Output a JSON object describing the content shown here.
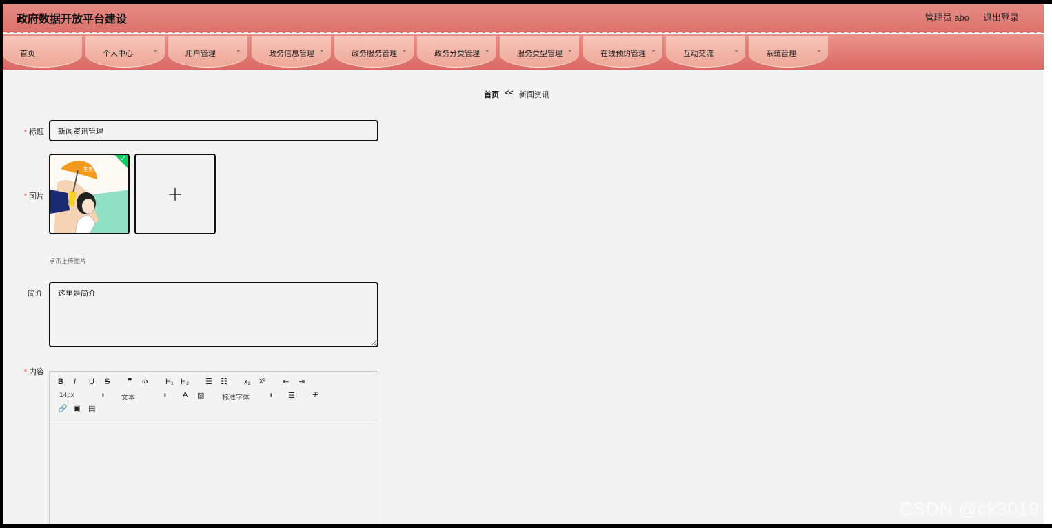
{
  "header": {
    "site_title": "政府数据开放平台建设",
    "user_label": "管理员 abo",
    "logout_label": "退出登录"
  },
  "nav": {
    "items": [
      {
        "label": "首页",
        "has_dropdown": false
      },
      {
        "label": "个人中心",
        "has_dropdown": true
      },
      {
        "label": "用户管理",
        "has_dropdown": true
      },
      {
        "label": "政务信息管理",
        "has_dropdown": true
      },
      {
        "label": "政务服务管理",
        "has_dropdown": true
      },
      {
        "label": "政务分类管理",
        "has_dropdown": true
      },
      {
        "label": "服务类型管理",
        "has_dropdown": true
      },
      {
        "label": "在线预约管理",
        "has_dropdown": true
      },
      {
        "label": "互动交流",
        "has_dropdown": true
      },
      {
        "label": "系统管理",
        "has_dropdown": true
      }
    ]
  },
  "breadcrumb": {
    "home": "首页",
    "separator": "<<",
    "current": "新闻资讯"
  },
  "form": {
    "title_label": "标题",
    "title_value": "新闻资讯管理",
    "picture_label": "图片",
    "picture_hint": "点击上传图片",
    "picture_thumb_text": "生育津贴",
    "intro_label": "简介",
    "intro_value": "这里是简介",
    "content_label": "内容"
  },
  "editor": {
    "toolbar": {
      "bold": "B",
      "italic": "I",
      "underline": "U",
      "strike": "S",
      "blockquote": "❞",
      "code": "‹/›",
      "h1": "H₁",
      "h2": "H₂",
      "ordered_list": "☰",
      "bullet_list": "☷",
      "subscript": "x₂",
      "superscript": "x²",
      "outdent": "⇤",
      "indent": "⇥",
      "size_select": "14px",
      "header_select": "文本",
      "font_select": "标准字体",
      "color": "A",
      "background": "▨",
      "align": "☰",
      "clean": "T",
      "link": "🔗",
      "image": "▣",
      "video": "▤"
    }
  },
  "watermark": "CSDN @ck3019",
  "colors": {
    "header_top": "#e48c85",
    "header_bottom": "#dd6f69",
    "nav_tab": "#f7c5b9",
    "required": "#e55555",
    "upload_success": "#13ce66",
    "page_bg": "#f3f3f3"
  }
}
